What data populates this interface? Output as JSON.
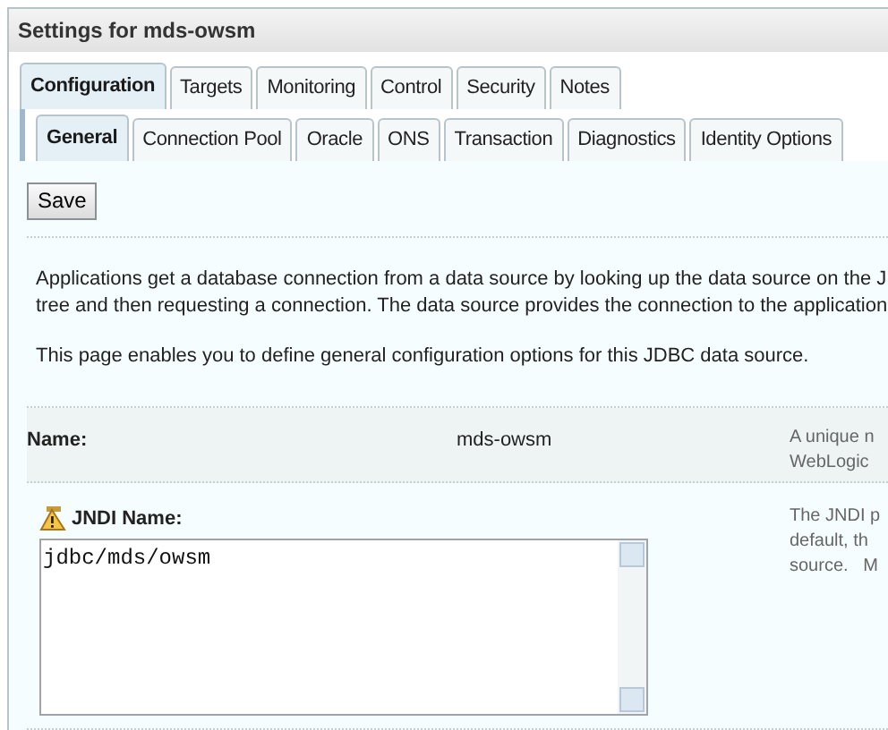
{
  "title": "Settings for mds-owsm",
  "tabs": [
    {
      "label": "Configuration",
      "selected": true
    },
    {
      "label": "Targets",
      "selected": false
    },
    {
      "label": "Monitoring",
      "selected": false
    },
    {
      "label": "Control",
      "selected": false
    },
    {
      "label": "Security",
      "selected": false
    },
    {
      "label": "Notes",
      "selected": false
    }
  ],
  "subtabs": [
    {
      "label": "General",
      "selected": true
    },
    {
      "label": "Connection Pool",
      "selected": false
    },
    {
      "label": "Oracle",
      "selected": false
    },
    {
      "label": "ONS",
      "selected": false
    },
    {
      "label": "Transaction",
      "selected": false
    },
    {
      "label": "Diagnostics",
      "selected": false
    },
    {
      "label": "Identity Options",
      "selected": false
    }
  ],
  "save_button": "Save",
  "intro": [
    [
      "Applications get a database connection from a data source by looking up the data source on the J",
      "tree and then requesting a connection. The data source provides the connection to the application"
    ],
    [
      "This page enables you to define general configuration options for this JDBC data source."
    ]
  ],
  "fields": [
    {
      "kind": "readonly",
      "label": "Name:",
      "value": "mds-owsm",
      "help": [
        "A unique n",
        "WebLogic"
      ]
    },
    {
      "kind": "textarea",
      "label": "JNDI Name:",
      "warning": true,
      "value": "jdbc/mds/owsm",
      "help": [
        "The JNDI p",
        "default, th",
        "source.   M"
      ]
    }
  ]
}
